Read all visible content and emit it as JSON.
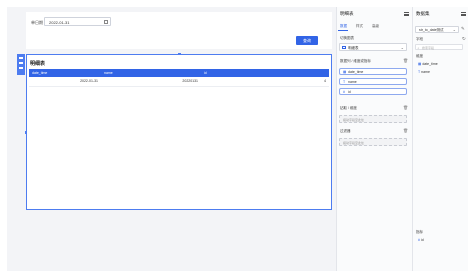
{
  "canvas": {
    "filter": {
      "label": "单日期",
      "date_value": "2022-01-31",
      "query_button": "查询"
    },
    "table": {
      "title": "明细表",
      "columns": [
        "date_time",
        "name",
        "id"
      ],
      "rows": [
        [
          "2022-01-31",
          "20220131",
          "4"
        ]
      ]
    }
  },
  "props_panel": {
    "title": "明细表",
    "tabs": [
      "数据",
      "样式",
      "高级"
    ],
    "active_tab": "数据",
    "chart_type_label": "切换图表",
    "chart_type_value": "明细表",
    "dimension_label": "数据列 / 维度或指标",
    "fields": [
      {
        "icon": "▦",
        "name": "date_time"
      },
      {
        "icon": "T",
        "name": "name"
      },
      {
        "icon": "#",
        "name": "id"
      }
    ],
    "sort_label": "钻取 / 维度",
    "sort_placeholder": "拖动字段至此处",
    "filter_label": "过滤器",
    "filter_placeholder": "拖动字段至此处"
  },
  "data_panel": {
    "title": "数据集",
    "dataset": "str_to_date测试",
    "fields_label": "字段",
    "search_placeholder": "搜索字段",
    "dimension_label": "维度",
    "dimensions": [
      {
        "icon": "▦",
        "name": "date_time"
      },
      {
        "icon": "T",
        "name": "name"
      }
    ],
    "metric_label": "指标",
    "metrics": [
      {
        "icon": "#",
        "name": "id"
      }
    ]
  },
  "colors": {
    "accent": "#3264e6",
    "table_header": "#3264e6",
    "selection_border": "#4d7cf0"
  }
}
